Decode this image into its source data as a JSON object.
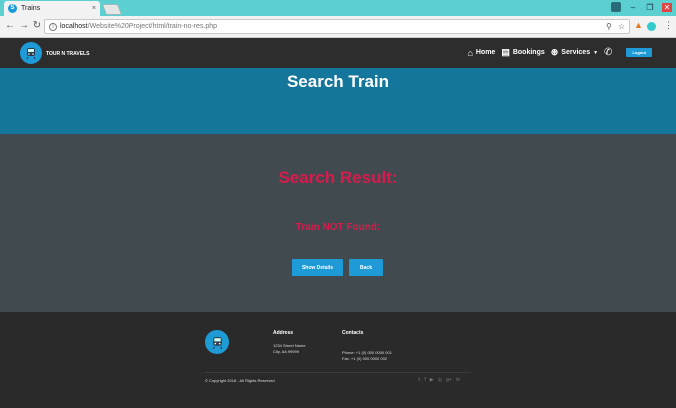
{
  "browser": {
    "tab_title": "Trains",
    "tab_close": "×",
    "url_prefix": "localhost",
    "url_path": "/Website%20Project/html/train-no-res.php"
  },
  "site": {
    "brand": "TOUR N TRAVELS",
    "nav": {
      "home": "Home",
      "bookings": "Bookings",
      "services": "Services",
      "logout": "Logout"
    }
  },
  "banner": {
    "title": "Search Train"
  },
  "main": {
    "result_title": "Search Result:",
    "not_found": "Train NOT Found:",
    "show_details": "Show Details",
    "back": "Back"
  },
  "footer": {
    "address_heading": "Address",
    "address_line1": "1234 Street Name",
    "address_line2": "City, AA 99999",
    "contacts_heading": "Contacts",
    "phone": "Phone: +1 (0) 000 0000 001",
    "fax": "Fax: +1 (0) 000 0000 002",
    "copyright": "© Copyright 2018 - All Rights Reserved"
  },
  "colors": {
    "accent": "#1e9bd7",
    "banner": "#14769a",
    "alert": "#d81b4d"
  }
}
